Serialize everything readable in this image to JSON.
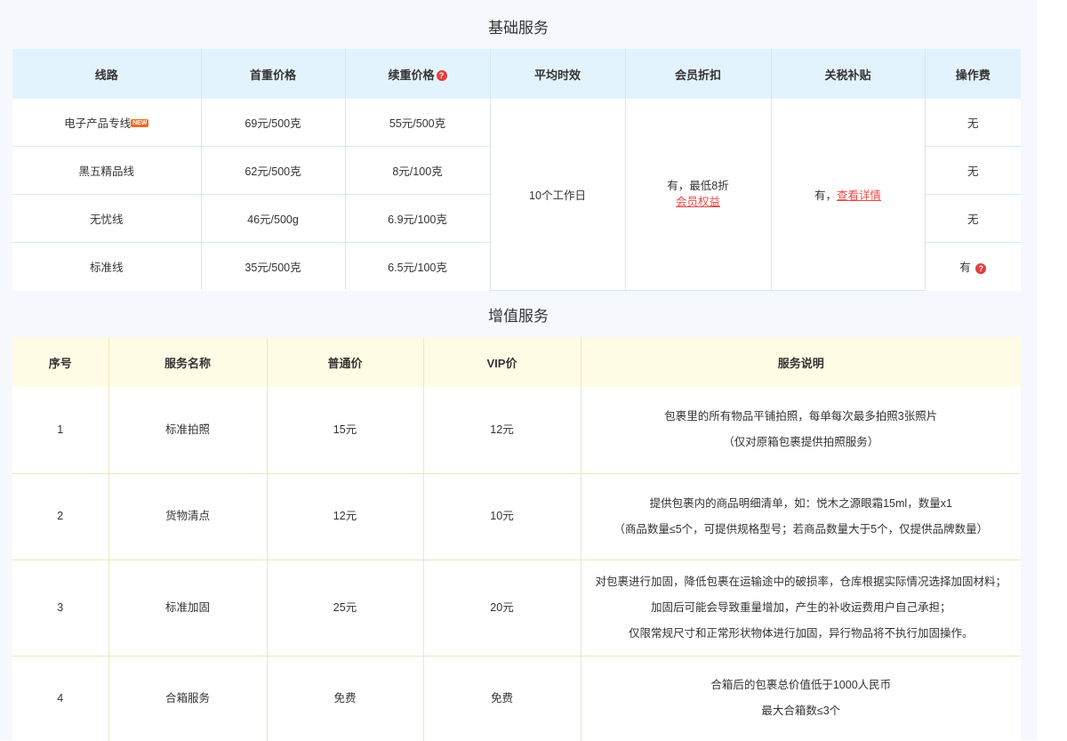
{
  "basic": {
    "title": "基础服务",
    "headers": {
      "route": "线路",
      "first_weight": "首重价格",
      "extra_weight": "续重价格",
      "delivery_time": "平均时效",
      "member_discount": "会员折扣",
      "tax_subsidy": "关税补贴",
      "handling_fee": "操作费"
    },
    "rows": [
      {
        "route": "电子产品专线",
        "badge": "NEW",
        "first": "69元/500克",
        "extra": "55元/500克",
        "fee": "无"
      },
      {
        "route": "黑五精品线",
        "first": "62元/500克",
        "extra": "8元/100克",
        "fee": "无"
      },
      {
        "route": "无忧线",
        "first": "46元/500g",
        "extra": "6.9元/100克",
        "fee": "无"
      },
      {
        "route": "标准线",
        "first": "35元/500克",
        "extra": "6.5元/100克",
        "fee": "有"
      }
    ],
    "delivery_time": "10个工作日",
    "member_discount": {
      "text": "有，最低8折",
      "link": "会员权益"
    },
    "tax_subsidy": {
      "text": "有，",
      "link": "查看详情"
    },
    "help_glyph": "?"
  },
  "value_added": {
    "title": "增值服务",
    "headers": {
      "no": "序号",
      "name": "服务名称",
      "normal_price": "普通价",
      "vip_price": "VIP价",
      "description": "服务说明"
    },
    "rows": [
      {
        "no": "1",
        "name": "标准拍照",
        "normal": "15元",
        "vip": "12元",
        "desc": [
          "包裹里的所有物品平铺拍照，每单每次最多拍照3张照片",
          "（仅对原箱包裹提供拍照服务）"
        ]
      },
      {
        "no": "2",
        "name": "货物清点",
        "normal": "12元",
        "vip": "10元",
        "desc": [
          "提供包裹内的商品明细清单，如：悦木之源眼霜15ml，数量x1",
          "（商品数量≤5个，可提供规格型号；若商品数量大于5个，仅提供品牌数量）"
        ]
      },
      {
        "no": "3",
        "name": "标准加固",
        "normal": "25元",
        "vip": "20元",
        "desc": [
          "对包裹进行加固，降低包裹在运输途中的破损率，仓库根据实际情况选择加固材料；",
          "加固后可能会导致重量增加，产生的补收运费用户自己承担；",
          "仅限常规尺寸和正常形状物体进行加固，异行物品将不执行加固操作。"
        ]
      },
      {
        "no": "4",
        "name": "合箱服务",
        "normal": "免费",
        "vip": "免费",
        "desc": [
          "合箱后的包裹总价值低于1000人民币",
          "最大合箱数≤3个"
        ]
      }
    ]
  }
}
